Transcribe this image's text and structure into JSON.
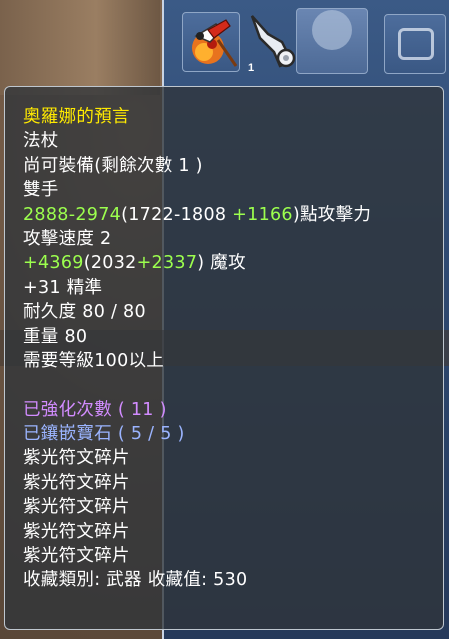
{
  "item": {
    "name": "奧羅娜的預言",
    "type": "法杖",
    "tradeable": "尚可裝備(剩餘次數 1 )",
    "hands": "雙手",
    "attack": {
      "range": "2888-2974",
      "base_open": "(1722-1808 ",
      "bonus": "+1166",
      "suffix": ")點攻擊力"
    },
    "attack_speed": "攻擊速度 2",
    "magic": {
      "total": "+4369",
      "base_open": "(2032",
      "bonus": "+2337",
      "suffix": ") 魔攻"
    },
    "accuracy": "+31 精準",
    "durability": "耐久度 80 / 80",
    "weight": "重量 80",
    "level_req": "需要等級100以上",
    "enhance": "已強化次數 ( 11 )",
    "gems": "已鑲嵌寶石 ( 5 / 5 )",
    "runes": [
      "紫光符文碎片",
      "紫光符文碎片",
      "紫光符文碎片",
      "紫光符文碎片",
      "紫光符文碎片"
    ],
    "collection": "收藏類別: 武器 收藏值: 530"
  },
  "slot_level": "1",
  "icons": {
    "weapon": "staff-weapon-icon",
    "wing": "wing-accessory-icon"
  },
  "colors": {
    "name": "#ffea00",
    "bonus": "#9cff4e",
    "enhance": "#d28cff",
    "gems": "#9bb4ff",
    "text": "#ffffff"
  }
}
